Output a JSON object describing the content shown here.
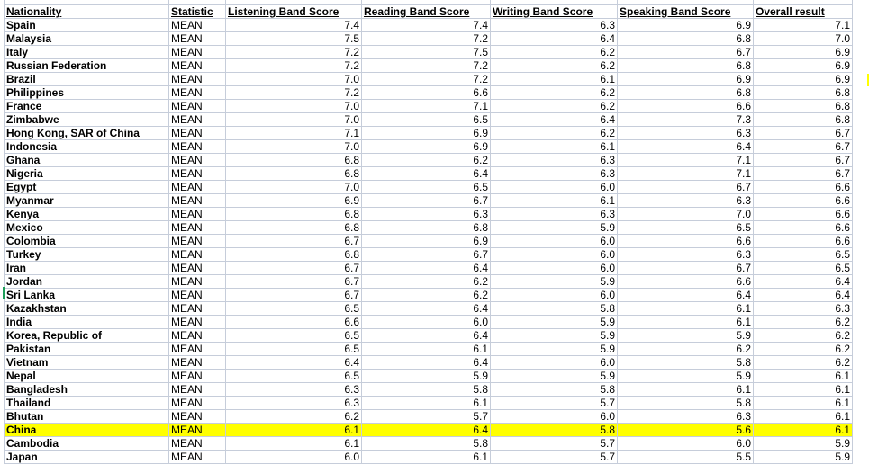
{
  "sheet": {
    "headers": [
      "Nationality",
      "Statistic",
      "Listening Band Score",
      "Reading Band Score",
      "Writing Band Score",
      "Speaking Band Score",
      "Overall result"
    ],
    "highlight_color": "#ffff00",
    "highlighted_row": "China",
    "rows": [
      {
        "nationality": "Spain",
        "statistic": "MEAN",
        "listening": "7.4",
        "reading": "7.4",
        "writing": "6.3",
        "speaking": "6.9",
        "overall": "7.1"
      },
      {
        "nationality": "Malaysia",
        "statistic": "MEAN",
        "listening": "7.5",
        "reading": "7.2",
        "writing": "6.4",
        "speaking": "6.8",
        "overall": "7.0"
      },
      {
        "nationality": "Italy",
        "statistic": "MEAN",
        "listening": "7.2",
        "reading": "7.5",
        "writing": "6.2",
        "speaking": "6.7",
        "overall": "6.9"
      },
      {
        "nationality": "Russian Federation",
        "statistic": "MEAN",
        "listening": "7.2",
        "reading": "7.2",
        "writing": "6.2",
        "speaking": "6.8",
        "overall": "6.9"
      },
      {
        "nationality": "Brazil",
        "statistic": "MEAN",
        "listening": "7.0",
        "reading": "7.2",
        "writing": "6.1",
        "speaking": "6.9",
        "overall": "6.9"
      },
      {
        "nationality": "Philippines",
        "statistic": "MEAN",
        "listening": "7.2",
        "reading": "6.6",
        "writing": "6.2",
        "speaking": "6.8",
        "overall": "6.8"
      },
      {
        "nationality": "France",
        "statistic": "MEAN",
        "listening": "7.0",
        "reading": "7.1",
        "writing": "6.2",
        "speaking": "6.6",
        "overall": "6.8"
      },
      {
        "nationality": "Zimbabwe",
        "statistic": "MEAN",
        "listening": "7.0",
        "reading": "6.5",
        "writing": "6.4",
        "speaking": "7.3",
        "overall": "6.8"
      },
      {
        "nationality": "Hong Kong, SAR of China",
        "statistic": "MEAN",
        "listening": "7.1",
        "reading": "6.9",
        "writing": "6.2",
        "speaking": "6.3",
        "overall": "6.7"
      },
      {
        "nationality": "Indonesia",
        "statistic": "MEAN",
        "listening": "7.0",
        "reading": "6.9",
        "writing": "6.1",
        "speaking": "6.4",
        "overall": "6.7"
      },
      {
        "nationality": "Ghana",
        "statistic": "MEAN",
        "listening": "6.8",
        "reading": "6.2",
        "writing": "6.3",
        "speaking": "7.1",
        "overall": "6.7"
      },
      {
        "nationality": "Nigeria",
        "statistic": "MEAN",
        "listening": "6.8",
        "reading": "6.4",
        "writing": "6.3",
        "speaking": "7.1",
        "overall": "6.7"
      },
      {
        "nationality": "Egypt",
        "statistic": "MEAN",
        "listening": "7.0",
        "reading": "6.5",
        "writing": "6.0",
        "speaking": "6.7",
        "overall": "6.6"
      },
      {
        "nationality": "Myanmar",
        "statistic": "MEAN",
        "listening": "6.9",
        "reading": "6.7",
        "writing": "6.1",
        "speaking": "6.3",
        "overall": "6.6"
      },
      {
        "nationality": "Kenya",
        "statistic": "MEAN",
        "listening": "6.8",
        "reading": "6.3",
        "writing": "6.3",
        "speaking": "7.0",
        "overall": "6.6"
      },
      {
        "nationality": "Mexico",
        "statistic": "MEAN",
        "listening": "6.8",
        "reading": "6.8",
        "writing": "5.9",
        "speaking": "6.5",
        "overall": "6.6"
      },
      {
        "nationality": "Colombia",
        "statistic": "MEAN",
        "listening": "6.7",
        "reading": "6.9",
        "writing": "6.0",
        "speaking": "6.6",
        "overall": "6.6"
      },
      {
        "nationality": "Turkey",
        "statistic": "MEAN",
        "listening": "6.8",
        "reading": "6.7",
        "writing": "6.0",
        "speaking": "6.3",
        "overall": "6.5"
      },
      {
        "nationality": "Iran",
        "statistic": "MEAN",
        "listening": "6.7",
        "reading": "6.4",
        "writing": "6.0",
        "speaking": "6.7",
        "overall": "6.5"
      },
      {
        "nationality": "Jordan",
        "statistic": "MEAN",
        "listening": "6.7",
        "reading": "6.2",
        "writing": "5.9",
        "speaking": "6.6",
        "overall": "6.4"
      },
      {
        "nationality": "Sri Lanka",
        "statistic": "MEAN",
        "listening": "6.7",
        "reading": "6.2",
        "writing": "6.0",
        "speaking": "6.4",
        "overall": "6.4"
      },
      {
        "nationality": "Kazakhstan",
        "statistic": "MEAN",
        "listening": "6.5",
        "reading": "6.4",
        "writing": "5.8",
        "speaking": "6.1",
        "overall": "6.3"
      },
      {
        "nationality": "India",
        "statistic": "MEAN",
        "listening": "6.6",
        "reading": "6.0",
        "writing": "5.9",
        "speaking": "6.1",
        "overall": "6.2"
      },
      {
        "nationality": "Korea, Republic of",
        "statistic": "MEAN",
        "listening": "6.5",
        "reading": "6.4",
        "writing": "5.9",
        "speaking": "5.9",
        "overall": "6.2"
      },
      {
        "nationality": "Pakistan",
        "statistic": "MEAN",
        "listening": "6.5",
        "reading": "6.1",
        "writing": "5.9",
        "speaking": "6.2",
        "overall": "6.2"
      },
      {
        "nationality": "Vietnam",
        "statistic": "MEAN",
        "listening": "6.4",
        "reading": "6.4",
        "writing": "6.0",
        "speaking": "5.8",
        "overall": "6.2"
      },
      {
        "nationality": "Nepal",
        "statistic": "MEAN",
        "listening": "6.5",
        "reading": "5.9",
        "writing": "5.9",
        "speaking": "5.9",
        "overall": "6.1"
      },
      {
        "nationality": "Bangladesh",
        "statistic": "MEAN",
        "listening": "6.3",
        "reading": "5.8",
        "writing": "5.8",
        "speaking": "6.1",
        "overall": "6.1"
      },
      {
        "nationality": "Thailand",
        "statistic": "MEAN",
        "listening": "6.3",
        "reading": "6.1",
        "writing": "5.7",
        "speaking": "5.8",
        "overall": "6.1"
      },
      {
        "nationality": "Bhutan",
        "statistic": "MEAN",
        "listening": "6.2",
        "reading": "5.7",
        "writing": "6.0",
        "speaking": "6.3",
        "overall": "6.1"
      },
      {
        "nationality": "China",
        "statistic": "MEAN",
        "listening": "6.1",
        "reading": "6.4",
        "writing": "5.8",
        "speaking": "5.6",
        "overall": "6.1"
      },
      {
        "nationality": "Cambodia",
        "statistic": "MEAN",
        "listening": "6.1",
        "reading": "5.8",
        "writing": "5.7",
        "speaking": "6.0",
        "overall": "5.9"
      },
      {
        "nationality": "Japan",
        "statistic": "MEAN",
        "listening": "6.0",
        "reading": "6.1",
        "writing": "5.7",
        "speaking": "5.5",
        "overall": "5.9"
      }
    ]
  }
}
